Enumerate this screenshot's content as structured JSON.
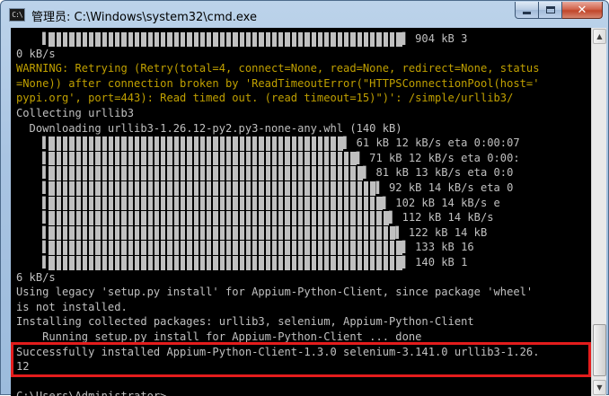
{
  "window": {
    "title": "管理员: C:\\Windows\\system32\\cmd.exe",
    "icon": "terminal-icon",
    "app_icon_text": "C:\\",
    "buttons": {
      "minimize": "minimize-icon",
      "maximize": "maximize-icon",
      "close": "close-icon",
      "close_glyph": "✕"
    }
  },
  "console": {
    "lines": [
      "    ▌                                                      ▌ 904 kB 3",
      "0 kB/s",
      "WARNING: Retrying (Retry(total=4, connect=None, read=None, redirect=None, status",
      "=None)) after connection broken by 'ReadTimeoutError(\"HTTPSConnectionPool(host='",
      "pypi.org', port=443): Read timed out. (read timeout=15)\")': /simple/urllib3/",
      "Collecting urllib3",
      "  Downloading urllib3-1.26.12-py2.py3-none-any.whl (140 kB)",
      "    ▌                                             ▌ 61 kB 12 kB/s eta 0:00:07",
      "    ▌                                               ▌ 71 kB 12 kB/s eta 0:00:",
      "    ▌                                                ▌ 81 kB 13 kB/s eta 0:0",
      "    ▌                                                  ▌ 92 kB 14 kB/s eta 0",
      "    ▌                                                   ▌ 102 kB 14 kB/s e",
      "    ▌                                                    ▌ 112 kB 14 kB/s",
      "    ▌                                                     ▌ 122 kB 14 kB",
      "    ▌                                                      ▌ 133 kB 16",
      "    ▌                                                      ▌ 140 kB 1",
      "6 kB/s",
      "Using legacy 'setup.py install' for Appium-Python-Client, since package 'wheel'",
      "is not installed.",
      "Installing collected packages: urllib3, selenium, Appium-Python-Client",
      "    Running setup.py install for Appium-Python-Client ... done",
      "Successfully installed Appium-Python-Client-1.3.0 selenium-3.141.0 urllib3-1.26.",
      "12",
      "",
      "C:\\Users\\Administrator>"
    ],
    "warning_line_indices": [
      2,
      3,
      4
    ],
    "highlighted_line_indices": [
      21,
      22
    ],
    "progress_rows": [
      {
        "fraction_complete": 1.0
      },
      {
        "fraction_complete": 0.44
      },
      {
        "fraction_complete": 0.51
      },
      {
        "fraction_complete": 0.58
      },
      {
        "fraction_complete": 0.66
      },
      {
        "fraction_complete": 0.73
      },
      {
        "fraction_complete": 0.8
      },
      {
        "fraction_complete": 0.87
      },
      {
        "fraction_complete": 0.95
      },
      {
        "fraction_complete": 1.0
      }
    ]
  },
  "colors": {
    "console_bg": "#000000",
    "console_text": "#c0c0c0",
    "warning_text": "#c0a000",
    "highlight_border": "#e31c1c"
  }
}
